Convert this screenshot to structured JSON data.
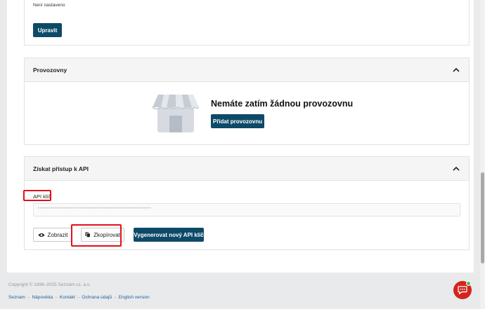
{
  "top": {
    "status_text": "Není nastaveno",
    "edit_button": "Upravit"
  },
  "provozovny": {
    "title": "Provozovny",
    "empty_message": "Nemáte zatím žádnou provozovnu",
    "add_button": "Přidat provozovnu"
  },
  "api": {
    "title": "Získat přístup k API",
    "key_label": "API klíč",
    "key_value": "••••••••••••••••••••••••••••••••••••••••••••••••••••••••••••••",
    "show_button": "Zobrazit",
    "copy_button": "Zkopírovat",
    "regenerate_button": "Vygenerovat nový API klíč"
  },
  "footer": {
    "copyright": "Copyright © 1996–2025 Seznam.cz, a.s.",
    "links": [
      "Seznam",
      "Nápověda",
      "Kontakt",
      "Ochrana údajů",
      "English version"
    ]
  },
  "colors": {
    "primary": "#0d4a67",
    "highlight": "#e0101a",
    "chat": "#d4251d"
  }
}
